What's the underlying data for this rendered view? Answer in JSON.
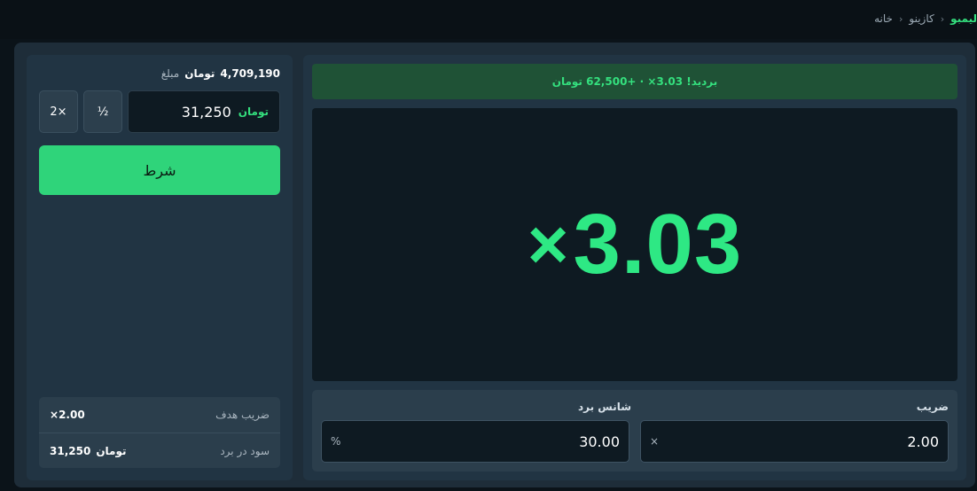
{
  "breadcrumb": {
    "items": [
      "خانه",
      "کازینو",
      "لیمبو"
    ]
  },
  "balance": {
    "label": "مبلغ",
    "currency": "تومان",
    "value": "4,709,190"
  },
  "bet": {
    "currency": "تومان",
    "amount": "31,250",
    "half_label": "½",
    "double_label": "2×",
    "button_label": "شرط"
  },
  "stats": {
    "target_label": "ضریب هدف",
    "target_value": "2.00×",
    "profit_label": "سود در برد",
    "profit_currency": "تومان",
    "profit_value": "31,250"
  },
  "result": {
    "banner": "بردید! 3.03× · +62,500 تومان",
    "multiplier": "3.03",
    "multiplier_symbol": "×"
  },
  "controls": {
    "multiplier_label": "ضریب",
    "multiplier_value": "2.00",
    "multiplier_suffix": "×",
    "chance_label": "شانس برد",
    "chance_value": "30.00",
    "chance_suffix": "%"
  },
  "colors": {
    "accent": "#34e07e",
    "bet_button": "#2fd47a",
    "banner_bg": "#1f5236"
  }
}
